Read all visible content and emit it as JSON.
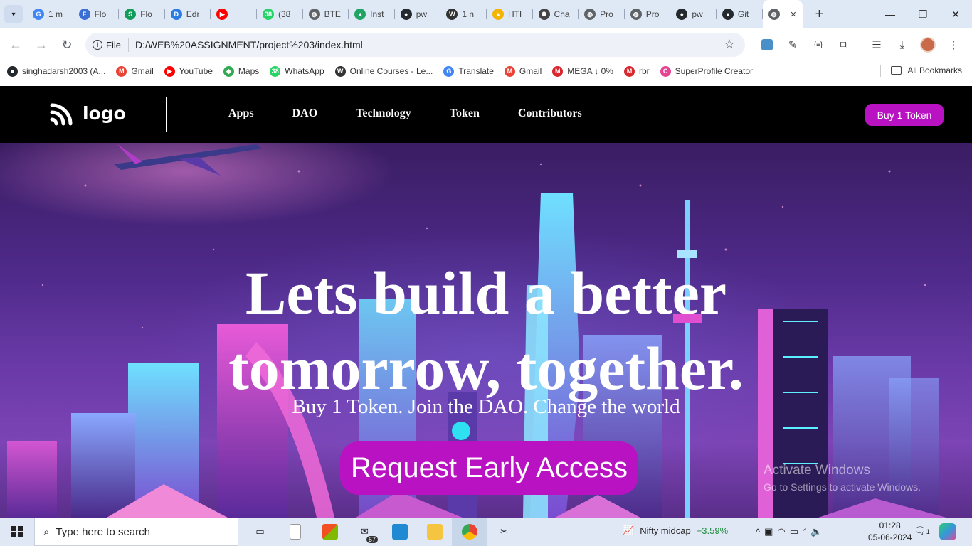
{
  "browser": {
    "tabs": [
      {
        "label": "1 m",
        "icon": "google-icon",
        "color": "#4285f4",
        "glyph": "G"
      },
      {
        "label": "Flo",
        "icon": "flowchart-icon",
        "color": "#3b6fd4",
        "glyph": "F"
      },
      {
        "label": "Flo",
        "icon": "sheets-icon",
        "color": "#0f9d58",
        "glyph": "S"
      },
      {
        "label": "Edr",
        "icon": "edraw-icon",
        "color": "#2a7be4",
        "glyph": "D"
      },
      {
        "label": "",
        "icon": "youtube-icon",
        "color": "#ff0000",
        "glyph": "▶"
      },
      {
        "label": "(38",
        "icon": "whatsapp-icon",
        "color": "#25d366",
        "glyph": "38"
      },
      {
        "label": "BTE",
        "icon": "globe-icon",
        "color": "#5f6368",
        "glyph": "◍"
      },
      {
        "label": "Inst",
        "icon": "drive-icon",
        "color": "#1fa463",
        "glyph": "▲"
      },
      {
        "label": "pw",
        "icon": "github-icon",
        "color": "#24292e",
        "glyph": "●"
      },
      {
        "label": "1 n",
        "icon": "wordpress-icon",
        "color": "#333333",
        "glyph": "W"
      },
      {
        "label": "HTI",
        "icon": "drive-icon",
        "color": "#f4b400",
        "glyph": "▲"
      },
      {
        "label": "Cha",
        "icon": "openai-icon",
        "color": "#444444",
        "glyph": "✺"
      },
      {
        "label": "Pro",
        "icon": "globe-icon",
        "color": "#5f6368",
        "glyph": "◍"
      },
      {
        "label": "Pro",
        "icon": "globe-icon",
        "color": "#5f6368",
        "glyph": "◍"
      },
      {
        "label": "pw",
        "icon": "github-icon",
        "color": "#24292e",
        "glyph": "●"
      },
      {
        "label": "Git",
        "icon": "github-icon",
        "color": "#24292e",
        "glyph": "●"
      }
    ],
    "url": "D:/WEB%20ASSIGNMENT/project%203/index.html",
    "scheme_label": "File",
    "bookmarks": [
      {
        "label": "singhadarsh2003 (A...",
        "icon": "github-icon",
        "color": "#24292e",
        "glyph": "●"
      },
      {
        "label": "Gmail",
        "icon": "gmail-icon",
        "color": "#ea4335",
        "glyph": "M"
      },
      {
        "label": "YouTube",
        "icon": "youtube-icon",
        "color": "#ff0000",
        "glyph": "▶"
      },
      {
        "label": "Maps",
        "icon": "maps-icon",
        "color": "#34a853",
        "glyph": "◆"
      },
      {
        "label": "WhatsApp",
        "icon": "whatsapp-icon",
        "color": "#25d366",
        "glyph": "38"
      },
      {
        "label": "Online Courses - Le...",
        "icon": "wordpress-icon",
        "color": "#333333",
        "glyph": "W"
      },
      {
        "label": "Translate",
        "icon": "translate-icon",
        "color": "#4285f4",
        "glyph": "G"
      },
      {
        "label": "Gmail",
        "icon": "gmail-icon",
        "color": "#ea4335",
        "glyph": "M"
      },
      {
        "label": "MEGA ↓ 0%",
        "icon": "mega-icon",
        "color": "#d9272e",
        "glyph": "M"
      },
      {
        "label": "rbr",
        "icon": "mega-icon",
        "color": "#d9272e",
        "glyph": "M"
      },
      {
        "label": "SuperProfile Creator",
        "icon": "superprofile-icon",
        "color": "#e84393",
        "glyph": "C"
      }
    ],
    "all_bookmarks": "All Bookmarks"
  },
  "site": {
    "logo_text": "logo",
    "nav": [
      "Apps",
      "DAO",
      "Technology",
      "Token",
      "Contributors"
    ],
    "buy_button": "Buy 1 Token",
    "hero_title_line1": "Lets build a better",
    "hero_title_line2": "tomorrow, together.",
    "hero_subtitle": "Buy 1 Token. Join the DAO. Change the world",
    "cta": "Request Early Access",
    "accent": "#b912c2"
  },
  "watermark": {
    "line1": "Activate Windows",
    "line2": "Go to Settings to activate Windows."
  },
  "taskbar": {
    "search_placeholder": "Type here to search",
    "mail_badge": "57",
    "stock_name": "Nifty midcap",
    "stock_change": "+3.59%",
    "time": "01:28",
    "date": "05-06-2024",
    "notification_count": "1"
  }
}
